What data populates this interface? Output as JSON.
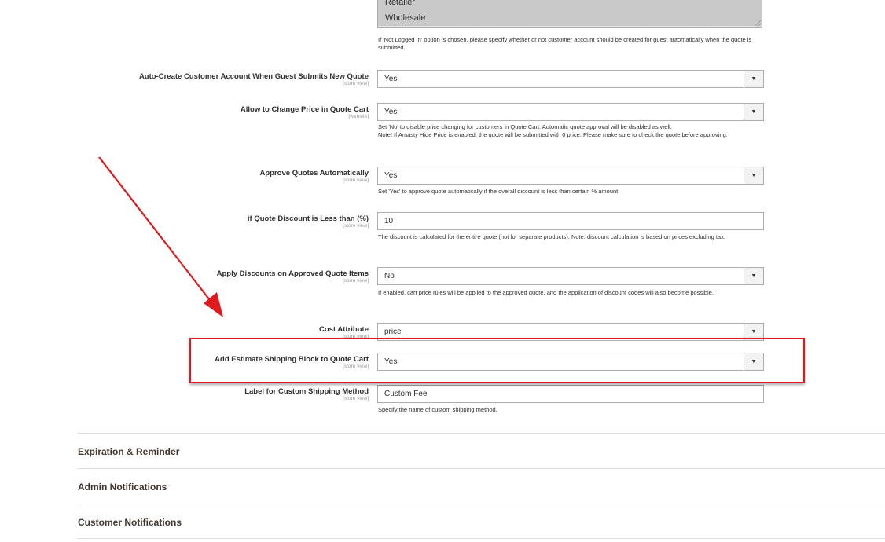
{
  "customer_groups": {
    "options": [
      "Retailer",
      "Wholesale"
    ]
  },
  "notes": {
    "guest_account": "If 'Not Logged In' option is chosen, please specify whether or not customer account should be created for guest automatically when the quote is submitted.",
    "change_price": "Set 'No' to disable price changing for customers in Quote Cart. Automatic quote approval will be disabled as well.",
    "change_price_2": "Note! If Amasty Hide Price is enabled, the quote will be submitted with 0 price. Please make sure to check the quote before approving.",
    "approve_auto": "Set 'Yes' to approve quote automatically if the overall discount is less than certain % amount",
    "discount_less": "The discount is calculated for the entire quote (not for separate products). Note: discount calculation is based on prices excluding tax.",
    "apply_discounts": "If enabled, cart price rules will be applied to the approved quote, and the application of discount codes will also become possible.",
    "custom_shipping": "Specify the name of custom shipping method."
  },
  "fields": {
    "auto_create": {
      "label": "Auto-Create Customer Account When Guest Submits New Quote",
      "scope": "[store view]",
      "value": "Yes"
    },
    "change_price": {
      "label": "Allow to Change Price in Quote Cart",
      "scope": "[website]",
      "value": "Yes"
    },
    "approve_auto": {
      "label": "Approve Quotes Automatically",
      "scope": "[store view]",
      "value": "Yes"
    },
    "discount_less": {
      "label": "if Quote Discount is Less than (%)",
      "scope": "[store view]",
      "value": "10"
    },
    "apply_discounts": {
      "label": "Apply Discounts on Approved Quote Items",
      "scope": "[store view]",
      "value": "No"
    },
    "cost_attribute": {
      "label": "Cost Attribute",
      "scope": "[store view]",
      "value": "price"
    },
    "estimate_shipping": {
      "label": "Add Estimate Shipping Block to Quote Cart",
      "scope": "[store view]",
      "value": "Yes"
    },
    "custom_shipping": {
      "label": "Label for Custom Shipping Method",
      "scope": "[store view]",
      "value": "Custom Fee"
    }
  },
  "sections": {
    "expiration": "Expiration & Reminder",
    "admin_notifications": "Admin Notifications",
    "customer_notifications": "Customer Notifications"
  },
  "icons": {
    "select_arrow": "caret-down-icon"
  },
  "colors": {
    "annotation_red": "#e0191f"
  }
}
